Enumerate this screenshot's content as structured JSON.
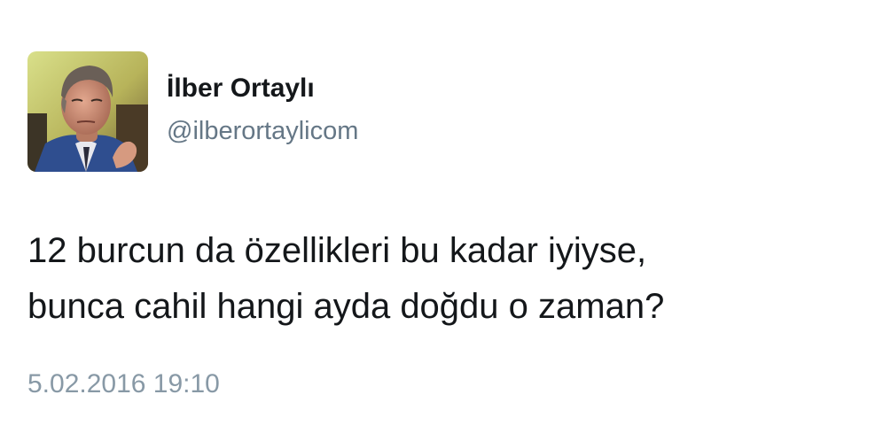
{
  "tweet": {
    "author": {
      "display_name": "İlber Ortaylı",
      "handle": "@ilberortaylicom",
      "avatar_icon": "profile-photo"
    },
    "text_lines": [
      "12 burcun da özellikleri bu kadar iyiyse,",
      "bunca cahil hangi ayda doğdu o zaman?"
    ],
    "timestamp": "5.02.2016 19:10"
  },
  "colors": {
    "name": "#14171a",
    "handle": "#657786",
    "timestamp": "#8899a6",
    "background": "#ffffff"
  }
}
